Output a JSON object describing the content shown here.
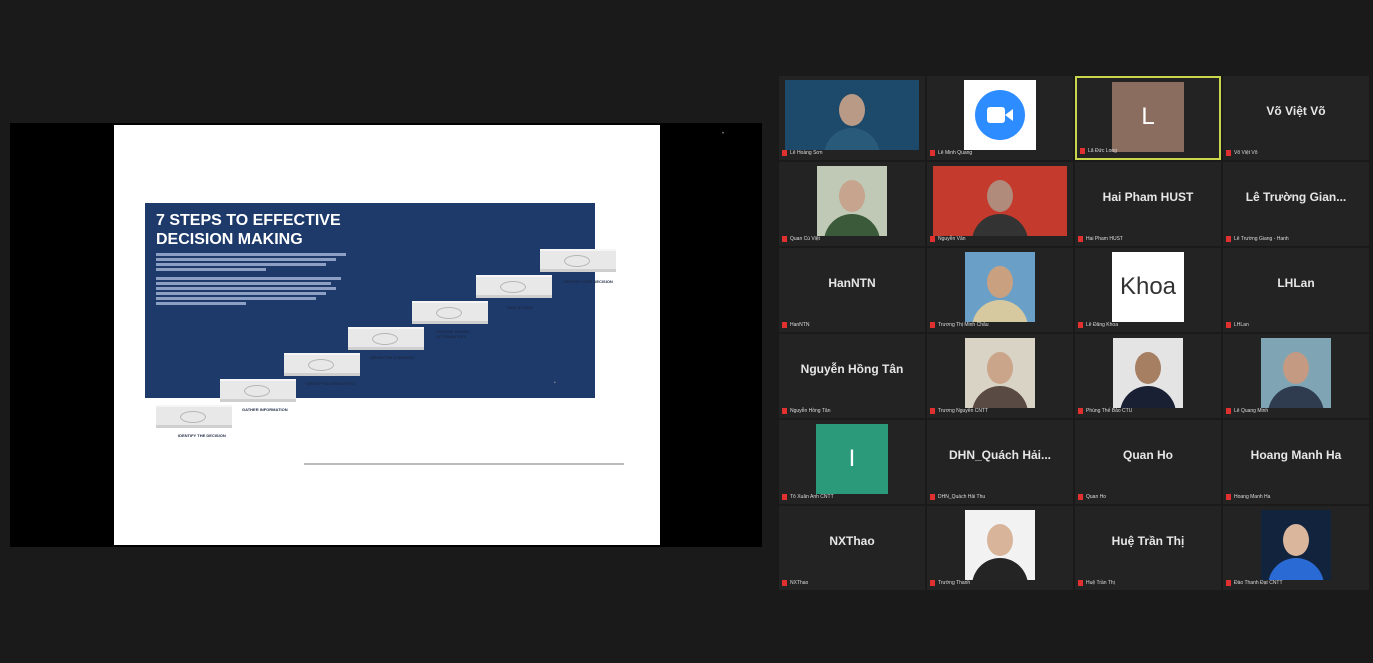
{
  "share": {
    "slide": {
      "title_line1": "7 STEPS TO EFFECTIVE",
      "title_line2": "DECISION MAKING",
      "steps": [
        "IDENTIFY THE DECISION",
        "GATHER INFORMATION",
        "IDENTIFY ALTERNATIVES",
        "WEIGH THE EVIDENCE",
        "CHOOSE AMONG ALTERNATIVES",
        "TAKE ACTION",
        "REVIEW YOUR DECISION"
      ]
    }
  },
  "gallery": {
    "tiles": [
      {
        "name": "",
        "caption": "Lê Hoàng Sơn"
      },
      {
        "name": "",
        "caption": "Lê Minh Quang"
      },
      {
        "name": "",
        "caption": "Lã Đức Long",
        "letter": "L",
        "active": true
      },
      {
        "name": "Võ Việt Võ",
        "caption": "Võ Việt Võ"
      },
      {
        "name": "",
        "caption": "Quan Cù Việt"
      },
      {
        "name": "",
        "caption": "Nguyễn Văn"
      },
      {
        "name": "Hai Pham HUST",
        "caption": "Hai Pham HUST"
      },
      {
        "name": "Lê Trường Gian...",
        "caption": "Lê Trường Giang - Hanh"
      },
      {
        "name": "HanNTN",
        "caption": "HanNTN"
      },
      {
        "name": "",
        "caption": "Trương Thị Minh Châu"
      },
      {
        "name": "",
        "caption": "Lê Đăng Khoa",
        "logo_text": "Khoa"
      },
      {
        "name": "LHLan",
        "caption": "LHLan"
      },
      {
        "name": "Nguyễn Hồng Tân",
        "caption": "Nguyễn Hồng Tân"
      },
      {
        "name": "",
        "caption": "Trương Nguyễn CNTT"
      },
      {
        "name": "",
        "caption": "Phùng Thế Bảo CTU"
      },
      {
        "name": "",
        "caption": "Lê Quang Minh"
      },
      {
        "name": "",
        "caption": "Tô Xuân Anh CNTT",
        "letter": "I"
      },
      {
        "name": "DHN_Quách Hải...",
        "caption": "DHN_Quách Hải Thu"
      },
      {
        "name": "Quan Ho",
        "caption": "Quan Ho"
      },
      {
        "name": "Hoang Manh Ha",
        "caption": "Hoang Manh Ha"
      },
      {
        "name": "NXThao",
        "caption": "NXThao"
      },
      {
        "name": "",
        "caption": "Trường Thanh"
      },
      {
        "name": "Huệ Trần Thị",
        "caption": "Huệ Trần Thị"
      },
      {
        "name": "",
        "caption": "Đào Thanh Đạt CNTT"
      }
    ]
  },
  "colors": {
    "background": "#1a1a1a",
    "tile": "#232323",
    "active_border": "#c9d54a",
    "muted_mic": "#e03030",
    "slide_band": "#1e3a6b"
  }
}
